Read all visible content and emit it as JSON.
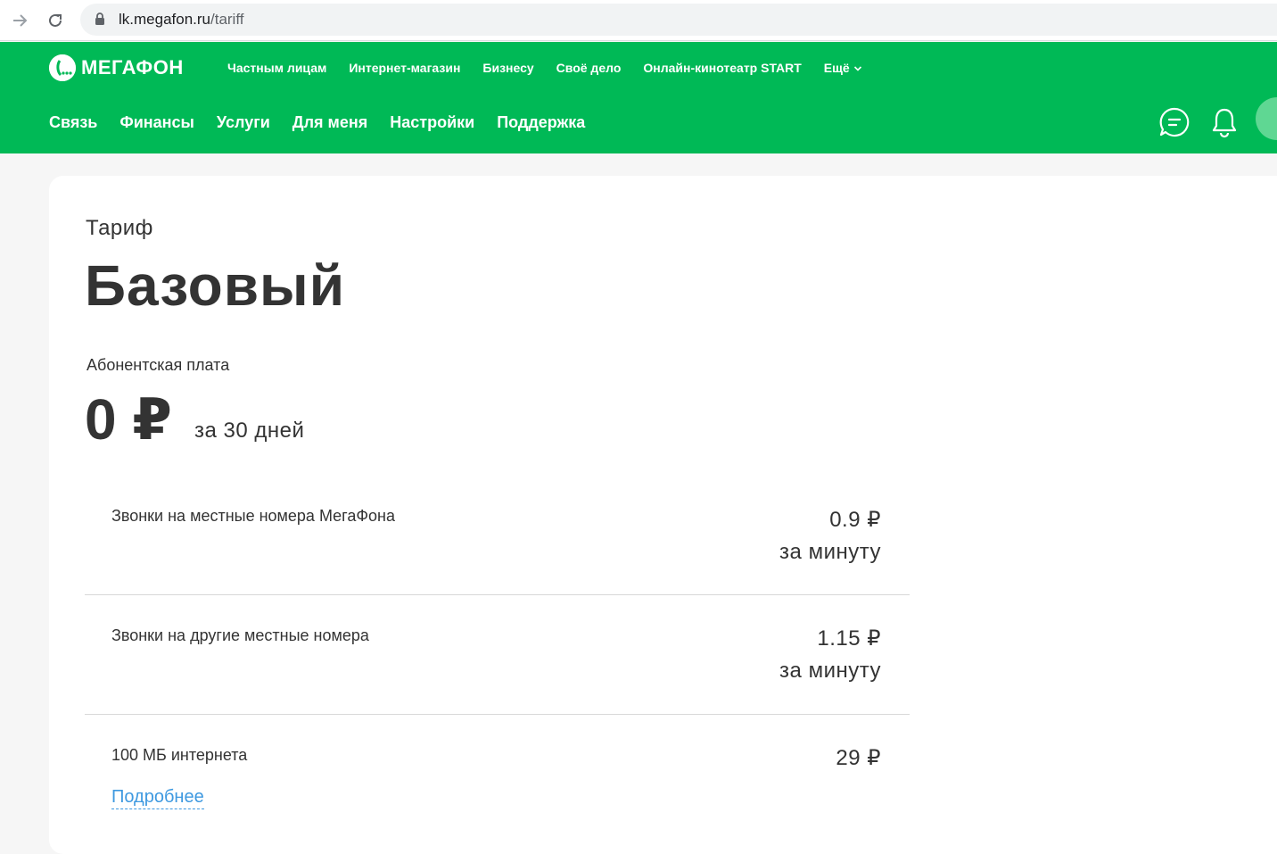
{
  "browser": {
    "url_host": "lk.megafon.ru",
    "url_path": "/tariff"
  },
  "header": {
    "logo_text": "МЕГАФОН",
    "top_nav": [
      "Частным лицам",
      "Интернет-магазин",
      "Бизнесу",
      "Своё дело",
      "Онлайн-кинотеатр START"
    ],
    "top_more": "Ещё",
    "main_nav": [
      "Связь",
      "Финансы",
      "Услуги",
      "Для меня",
      "Настройки",
      "Поддержка"
    ],
    "brand_color": "#00b956"
  },
  "tariff": {
    "label": "Тариф",
    "name": "Базовый",
    "fee_label": "Абонентская плата",
    "fee_value": "0 ₽",
    "fee_period": "за 30 дней",
    "items": [
      {
        "title": "Звонки на местные номера МегаФона",
        "price": "0.9 ₽",
        "unit": "за минуту"
      },
      {
        "title": "Звонки на другие местные номера",
        "price": "1.15 ₽",
        "unit": "за минуту"
      },
      {
        "title": "100 МБ интернета",
        "price": "29 ₽",
        "unit": ""
      }
    ],
    "more_link": "Подробнее"
  },
  "icons": [
    "back-arrow-icon",
    "reload-icon",
    "lock-icon",
    "chevron-down-icon",
    "chat-icon",
    "bell-icon"
  ]
}
